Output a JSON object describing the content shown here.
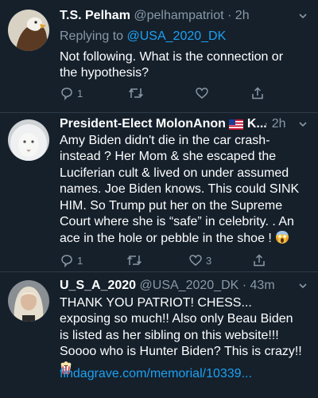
{
  "tweets": [
    {
      "display_name": "T.S. Pelham",
      "handle": "@pelhampatriot",
      "time": "· 2h",
      "replying_prefix": "Replying to ",
      "replying_to": "@USA_2020_DK",
      "text": "Not following.  What is the connection or the hypothesis?",
      "reply_count": "1",
      "retweet_count": "",
      "like_count": ""
    },
    {
      "display_name": "President-Elect MolonAnon",
      "name_suffix": "K...",
      "time": "· 2h",
      "text": "Amy Biden didn't die in the car crash- instead ? Her Mom & she escaped the Luciferian cult & lived on under assumed names. Joe Biden knows. This could SINK HIM. So Trump put her on the Supreme Court where she is “safe” in celebrity. . An ace in the hole or pebble in the shoe !",
      "reply_count": "1",
      "retweet_count": "",
      "like_count": "3"
    },
    {
      "display_name": "U_S_A_2020",
      "handle": "@USA_2020_DK",
      "time": "· 43m",
      "text": "THANK YOU PATRIOT! CHESS... exposing so much!! Also only Beau Biden is listed as her sibling on this website!!! Soooo who is Hunter Biden? This is crazy!!",
      "link": "findagrave.com/memorial/10339..."
    }
  ],
  "icons": {
    "reply": "reply-icon",
    "retweet": "retweet-icon",
    "like": "heart-icon",
    "share": "share-icon",
    "caret": "chevron-down-icon",
    "flag": "us-flag-icon",
    "scream": "screaming-face-icon",
    "popcorn": "popcorn-icon"
  },
  "colors": {
    "background": "#15202b",
    "muted": "#8899a6",
    "link": "#1da1f2",
    "text": "#ffffff"
  }
}
